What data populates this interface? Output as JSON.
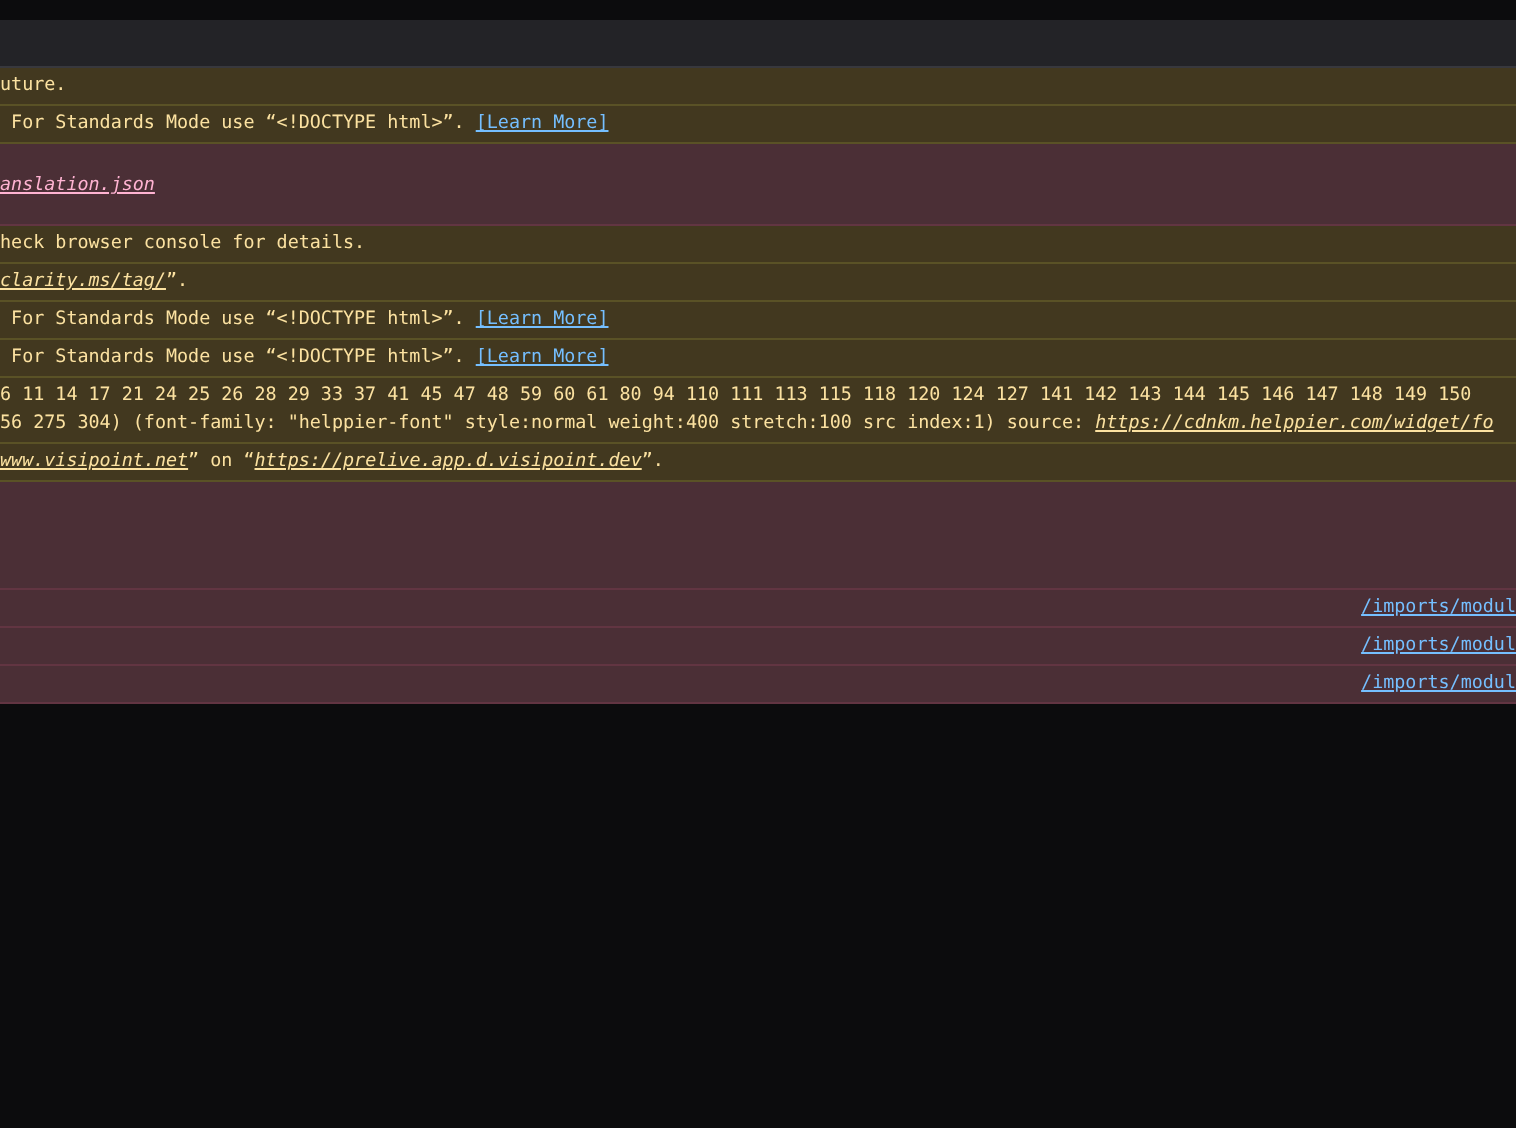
{
  "messages": [
    {
      "kind": "warning",
      "lines": [
        [
          {
            "kind": "text",
            "text": "uture."
          }
        ]
      ]
    },
    {
      "kind": "warning",
      "lines": [
        [
          {
            "kind": "text",
            "text": " For Standards Mode use “<!DOCTYPE html>”. "
          },
          {
            "kind": "doc_link",
            "text": "[Learn More]"
          }
        ]
      ]
    },
    {
      "kind": "error",
      "lines": [
        [
          {
            "kind": "url_link",
            "text": "anslation.json"
          }
        ]
      ]
    },
    {
      "kind": "warning",
      "lines": [
        [
          {
            "kind": "text",
            "text": "heck browser console for details."
          }
        ]
      ]
    },
    {
      "kind": "warning",
      "lines": [
        [
          {
            "kind": "url_link",
            "text": "clarity.ms/tag/"
          },
          {
            "kind": "text",
            "text": "”."
          }
        ]
      ]
    },
    {
      "kind": "warning",
      "lines": [
        [
          {
            "kind": "text",
            "text": " For Standards Mode use “<!DOCTYPE html>”. "
          },
          {
            "kind": "doc_link",
            "text": "[Learn More]"
          }
        ]
      ]
    },
    {
      "kind": "warning",
      "lines": [
        [
          {
            "kind": "text",
            "text": " For Standards Mode use “<!DOCTYPE html>”. "
          },
          {
            "kind": "doc_link",
            "text": "[Learn More]"
          }
        ]
      ]
    },
    {
      "kind": "warning",
      "lines": [
        [
          {
            "kind": "text",
            "text": "6 11 14 17 21 24 25 26 28 29 33 37 41 45 47 48 59 60 61 80 94 110 111 113 115 118 120 124 127 141 142 143 144 145 146 147 148 149 150"
          }
        ],
        [
          {
            "kind": "text",
            "text": "56 275 304) (font-family: \"helppier-font\" style:normal weight:400 stretch:100 src index:1) source: "
          },
          {
            "kind": "url_link",
            "text": "https://cdnkm.helppier.com/widget/fo"
          }
        ]
      ]
    },
    {
      "kind": "warning",
      "lines": [
        [
          {
            "kind": "url_link",
            "text": "www.visipoint.net"
          },
          {
            "kind": "text",
            "text": "” on “"
          },
          {
            "kind": "url_link",
            "text": "https://prelive.app.d.visipoint.dev"
          },
          {
            "kind": "text",
            "text": "”."
          }
        ]
      ]
    },
    {
      "kind": "error"
    },
    {
      "kind": "error",
      "source": "/imports/modul"
    },
    {
      "kind": "error",
      "source": "/imports/modul"
    },
    {
      "kind": "error",
      "source": "/imports/modul"
    }
  ]
}
